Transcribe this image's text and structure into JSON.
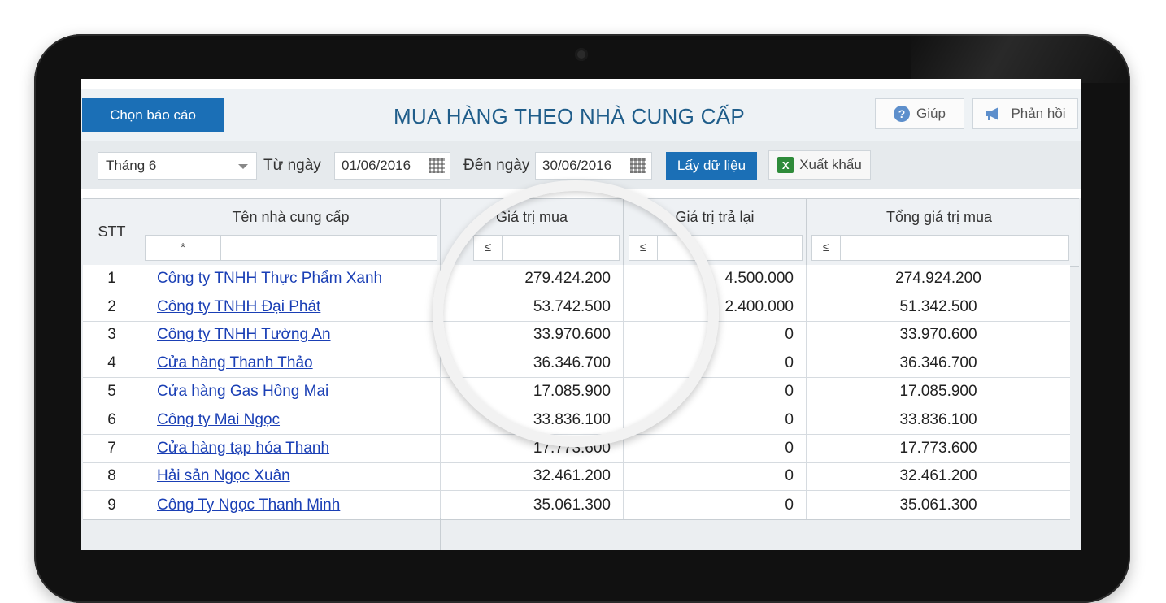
{
  "header": {
    "report_button": "Chọn báo cáo",
    "title": "MUA HÀNG THEO NHÀ CUNG CẤP",
    "help_button": "Giúp",
    "feedback_button": "Phản hồi"
  },
  "filter": {
    "period_value": "Tháng 6",
    "from_label": "Từ ngày",
    "from_value": "01/06/2016",
    "to_label": "Đến ngày",
    "to_value": "30/06/2016",
    "fetch_button": "Lấy dữ liệu",
    "export_button": "Xuất khẩu"
  },
  "table": {
    "columns": {
      "stt": "STT",
      "name": "Tên nhà cung cấp",
      "buy": "Giá trị mua",
      "ret": "Giá trị trả lại",
      "total": "Tổng giá trị mua"
    },
    "filters": {
      "name_op": "*",
      "buy_op": "≤",
      "ret_op": "≤",
      "total_op": "≤"
    },
    "rows": [
      {
        "stt": "1",
        "name": "Công ty TNHH Thực Phẩm Xanh",
        "buy": "279.424.200",
        "ret": "4.500.000",
        "total": "274.924.200"
      },
      {
        "stt": "2",
        "name": "Công ty TNHH Đại Phát",
        "buy": "53.742.500",
        "ret": "2.400.000",
        "total": "51.342.500"
      },
      {
        "stt": "3",
        "name": "Công ty TNHH Tường An",
        "buy": "33.970.600",
        "ret": "0",
        "total": "33.970.600"
      },
      {
        "stt": "4",
        "name": "Cửa hàng Thanh Thảo",
        "buy": "36.346.700",
        "ret": "0",
        "total": "36.346.700"
      },
      {
        "stt": "5",
        "name": "Cửa hàng Gas Hồng Mai",
        "buy": "17.085.900",
        "ret": "0",
        "total": "17.085.900"
      },
      {
        "stt": "6",
        "name": "Công ty Mai Ngọc",
        "buy": "33.836.100",
        "ret": "0",
        "total": "33.836.100"
      },
      {
        "stt": "7",
        "name": "Cửa hàng tạp hóa Thanh",
        "buy": "17.773.600",
        "ret": "0",
        "total": "17.773.600"
      },
      {
        "stt": "8",
        "name": "Hải sản Ngọc Xuân",
        "buy": "32.461.200",
        "ret": "0",
        "total": "32.461.200"
      },
      {
        "stt": "9",
        "name": "Công Ty Ngọc Thanh Minh",
        "buy": "35.061.300",
        "ret": "0",
        "total": "35.061.300"
      }
    ]
  }
}
